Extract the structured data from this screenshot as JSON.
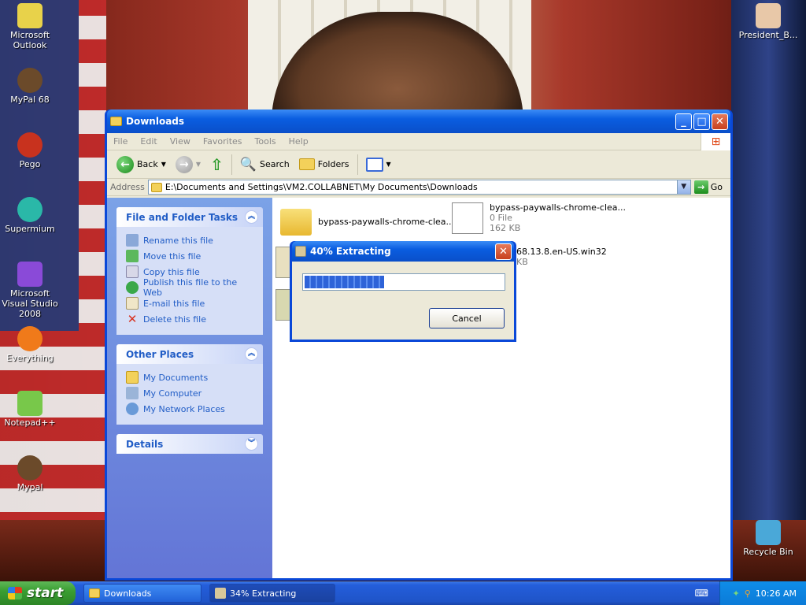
{
  "desktop": {
    "icons": [
      {
        "label": "Microsoft Outlook",
        "color": "#e8d24a"
      },
      {
        "label": "MyPal 68",
        "color": "#6b4a2a"
      },
      {
        "label": "Pego",
        "color": "#c8321e"
      },
      {
        "label": "Supermium",
        "color": "#2ab8a8"
      },
      {
        "label": "Microsoft Visual Studio 2008",
        "color": "#8a4ad8"
      },
      {
        "label": "Everything",
        "color": "#f07a1a"
      },
      {
        "label": "Notepad++",
        "color": "#78c84a"
      },
      {
        "label": "Mypal",
        "color": "#6b4a2a"
      },
      {
        "label": "President_B...",
        "color": "#e8c8a8"
      },
      {
        "label": "Recycle Bin",
        "color": "#4aa8d8"
      }
    ]
  },
  "window": {
    "title": "Downloads",
    "menu": [
      "File",
      "Edit",
      "View",
      "Favorites",
      "Tools",
      "Help"
    ],
    "toolbar": {
      "back": "Back",
      "search": "Search",
      "folders": "Folders"
    },
    "address": {
      "label": "Address",
      "value": "E:\\Documents and Settings\\VM2.COLLABNET\\My Documents\\Downloads",
      "go": "Go"
    },
    "tasks": {
      "title": "File and Folder Tasks",
      "items": [
        "Rename this file",
        "Move this file",
        "Copy this file",
        "Publish this file to the Web",
        "E-mail this file",
        "Delete this file"
      ]
    },
    "other_places": {
      "title": "Other Places",
      "items": [
        "My Documents",
        "My Computer",
        "My Network Places"
      ]
    },
    "details": {
      "title": "Details"
    },
    "files": [
      {
        "name": "bypass-paywalls-chrome-clea...",
        "type": "folder"
      },
      {
        "name": "bypass-paywalls-chrome-clea...",
        "line2": "0 File",
        "line3": "162 KB"
      },
      {
        "name": "68.13.8.en-US.win32",
        "line2": "KB"
      }
    ]
  },
  "dialog": {
    "title": "40% Extracting",
    "progress_percent": 40,
    "cancel": "Cancel"
  },
  "taskbar": {
    "start": "start",
    "tasks": [
      "Downloads",
      "34% Extracting"
    ],
    "clock": "10:26 AM"
  }
}
